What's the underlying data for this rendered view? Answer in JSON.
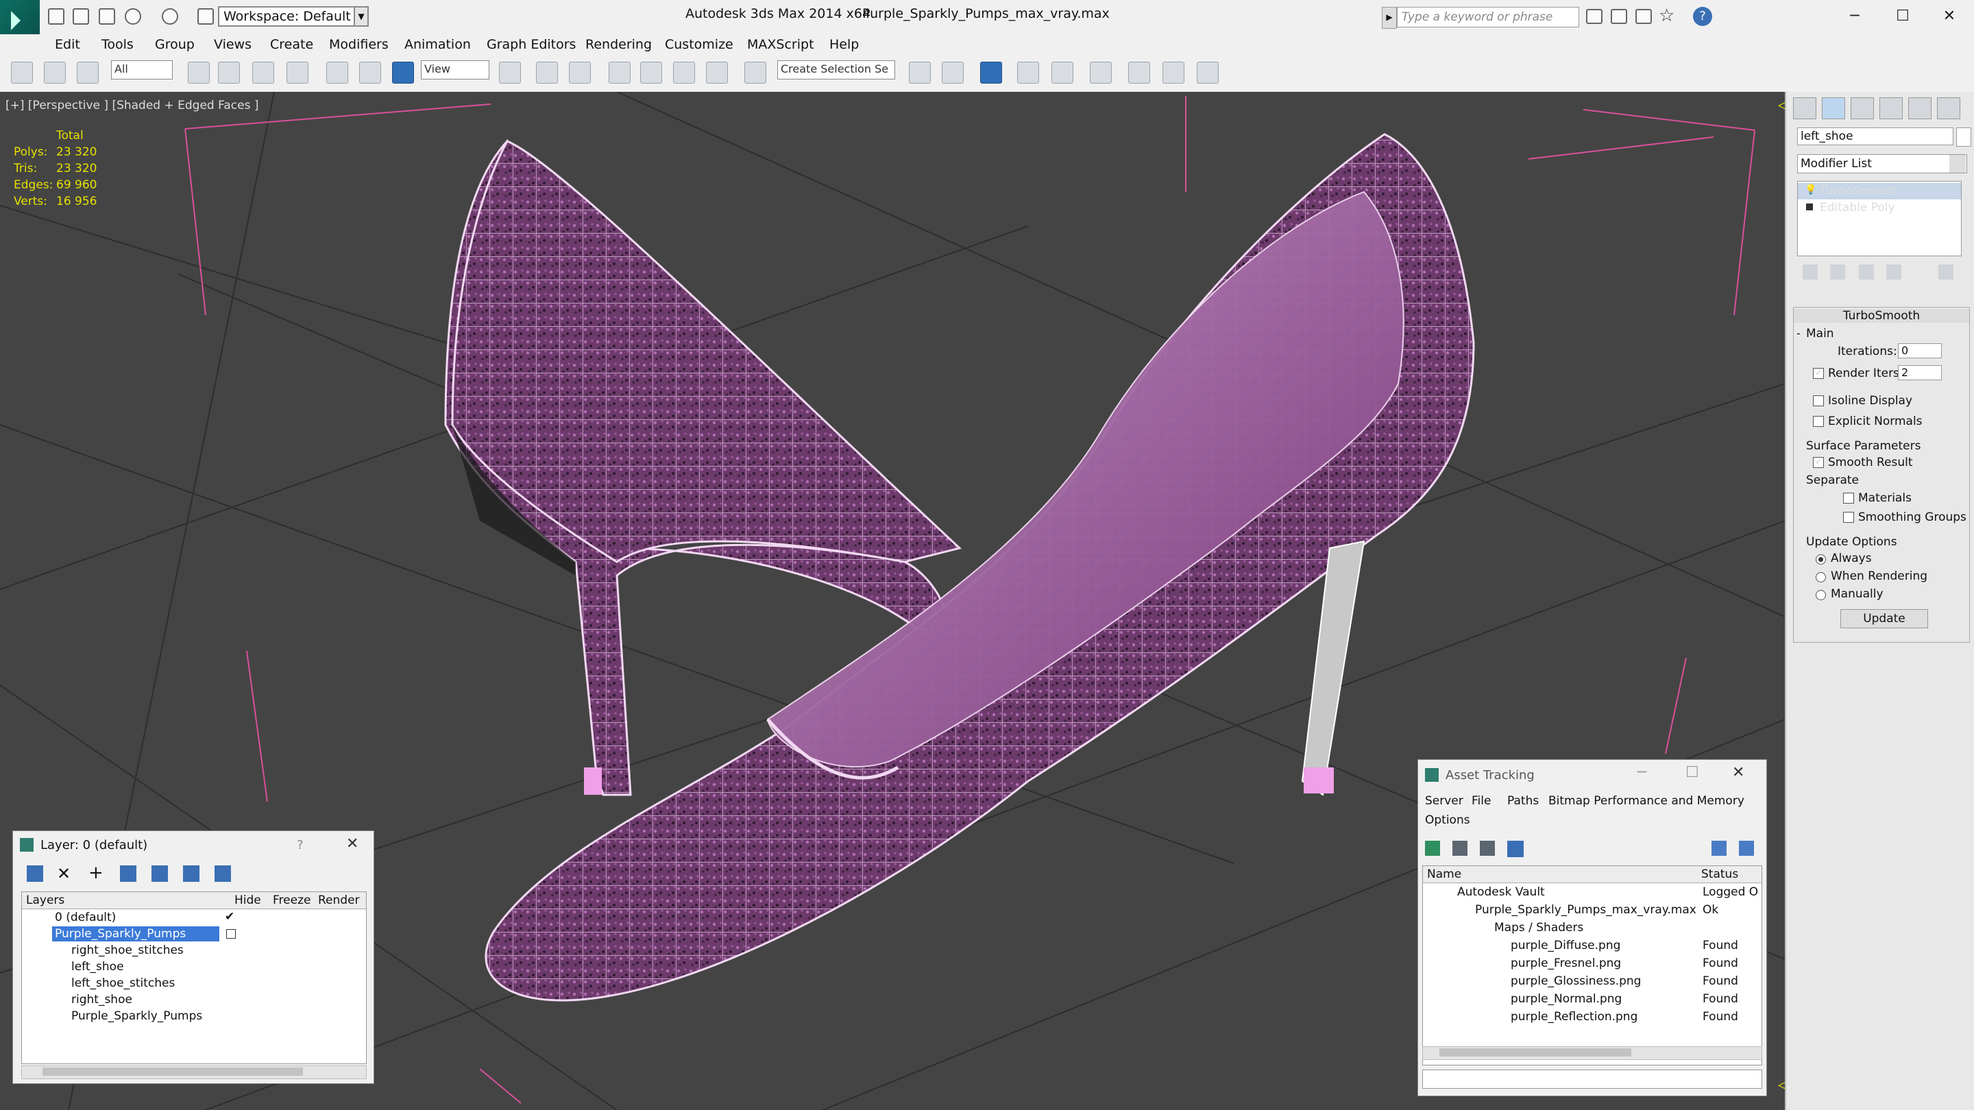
{
  "titlebar": {
    "workspace": "Workspace: Default",
    "app": "Autodesk 3ds Max  2014 x64",
    "file": "Purple_Sparkly_Pumps_max_vray.max",
    "search_placeholder": "Type a keyword or phrase"
  },
  "menu": [
    "Edit",
    "Tools",
    "Group",
    "Views",
    "Create",
    "Modifiers",
    "Animation",
    "Graph Editors",
    "Rendering",
    "Customize",
    "MAXScript",
    "Help"
  ],
  "toolbar": {
    "filter": "All",
    "ref_coord": "View",
    "selection_set": "Create Selection Se"
  },
  "viewport": {
    "label": "[+] [Perspective ] [Shaded + Edged Faces ]",
    "stats_header": "Total",
    "stats": [
      {
        "label": "Polys:",
        "value": "23 320"
      },
      {
        "label": "Tris:",
        "value": "23 320"
      },
      {
        "label": "Edges:",
        "value": "69 960"
      },
      {
        "label": "Verts:",
        "value": "16 956"
      }
    ]
  },
  "cmdpanel": {
    "object_name": "left_shoe",
    "modifier_list": "Modifier List",
    "stack": [
      "TurboSmooth",
      "Editable Poly"
    ],
    "rollout_title": "TurboSmooth",
    "main_label": "Main",
    "iterations_label": "Iterations:",
    "iterations_value": "0",
    "render_iters_label": "Render Iters:",
    "render_iters_value": "2",
    "isoline": "Isoline Display",
    "explicit_normals": "Explicit Normals",
    "surface_params": "Surface Parameters",
    "smooth_result": "Smooth Result",
    "separate": "Separate",
    "materials": "Materials",
    "smoothing_groups": "Smoothing Groups",
    "update_options": "Update Options",
    "always": "Always",
    "when_rendering": "When Rendering",
    "manually": "Manually",
    "update_button": "Update"
  },
  "layer_window": {
    "title": "Layer: 0 (default)",
    "help": "?",
    "headers": [
      "Layers",
      "Hide",
      "Freeze",
      "Render"
    ],
    "rows": [
      {
        "name": "0 (default)",
        "indent": 1,
        "selected": false
      },
      {
        "name": "Purple_Sparkly_Pumps",
        "indent": 1,
        "selected": true
      },
      {
        "name": "right_shoe_stitches",
        "indent": 2,
        "selected": false
      },
      {
        "name": "left_shoe",
        "indent": 2,
        "selected": false
      },
      {
        "name": "left_shoe_stitches",
        "indent": 2,
        "selected": false
      },
      {
        "name": "right_shoe",
        "indent": 2,
        "selected": false
      },
      {
        "name": "Purple_Sparkly_Pumps",
        "indent": 2,
        "selected": false
      }
    ]
  },
  "asset_window": {
    "title": "Asset Tracking",
    "menu": [
      "Server",
      "File",
      "Paths",
      "Bitmap Performance and Memory",
      "Options"
    ],
    "headers": [
      "Name",
      "Status"
    ],
    "rows": [
      {
        "name": "Autodesk Vault",
        "status": "Logged O",
        "indent": 0
      },
      {
        "name": "Purple_Sparkly_Pumps_max_vray.max",
        "status": "Ok",
        "indent": 1
      },
      {
        "name": "Maps / Shaders",
        "status": "",
        "indent": 2
      },
      {
        "name": "purple_Diffuse.png",
        "status": "Found",
        "indent": 3
      },
      {
        "name": "purple_Fresnel.png",
        "status": "Found",
        "indent": 3
      },
      {
        "name": "purple_Glossiness.png",
        "status": "Found",
        "indent": 3
      },
      {
        "name": "purple_Normal.png",
        "status": "Found",
        "indent": 3
      },
      {
        "name": "purple_Reflection.png",
        "status": "Found",
        "indent": 3
      }
    ]
  },
  "colors": {
    "shoe": "#7a3f78",
    "wire": "#f2d9f2",
    "grid": "#2a2a2a",
    "stats": "#e6e000"
  }
}
